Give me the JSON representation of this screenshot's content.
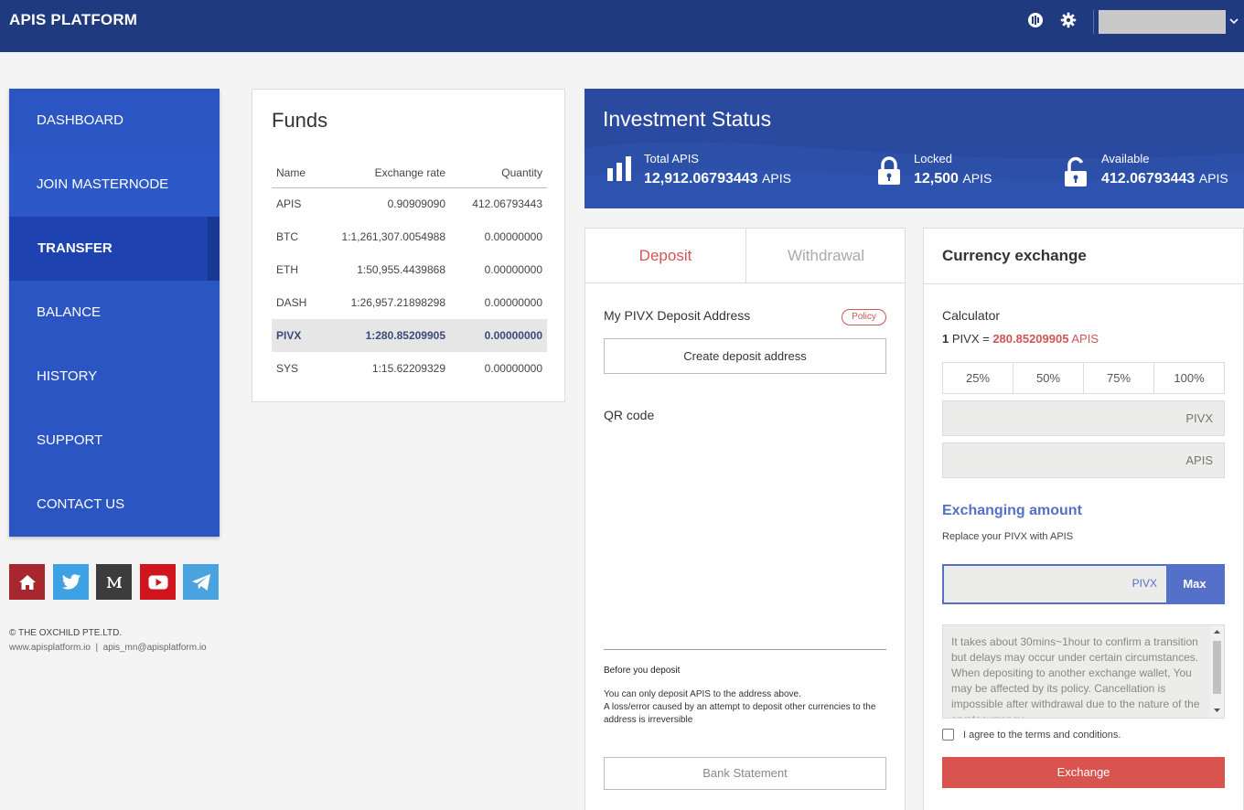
{
  "header": {
    "brand": "APIS PLATFORM"
  },
  "sidebar": {
    "items": [
      {
        "label": "DASHBOARD"
      },
      {
        "label": "JOIN MASTERNODE"
      },
      {
        "label": "TRANSFER"
      },
      {
        "label": "BALANCE"
      },
      {
        "label": "HISTORY"
      },
      {
        "label": "SUPPORT"
      },
      {
        "label": "CONTACT US"
      }
    ],
    "active": "TRANSFER",
    "social": [
      "home-icon",
      "twitter-icon",
      "medium-icon",
      "youtube-icon",
      "telegram-icon"
    ],
    "copyright": "© THE OXCHILD PTE.LTD.",
    "contact": "www.apisplatform.io  |  apis_mn@apisplatform.io"
  },
  "funds": {
    "title": "Funds",
    "headers": [
      "Name",
      "Exchange rate",
      "Quantity"
    ],
    "rows": [
      {
        "name": "APIS",
        "rate": "0.90909090",
        "qty": "412.06793443"
      },
      {
        "name": "BTC",
        "rate": "1:1,261,307.0054988",
        "qty": "0.00000000"
      },
      {
        "name": "ETH",
        "rate": "1:50,955.4439868",
        "qty": "0.00000000"
      },
      {
        "name": "DASH",
        "rate": "1:26,957.21898298",
        "qty": "0.00000000"
      },
      {
        "name": "PIVX",
        "rate": "1:280.85209905",
        "qty": "0.00000000"
      },
      {
        "name": "SYS",
        "rate": "1:15.62209329",
        "qty": "0.00000000"
      }
    ],
    "selected": "PIVX"
  },
  "investment": {
    "title": "Investment Status",
    "total": {
      "label": "Total APIS",
      "value": "12,912.06793443",
      "unit": "APIS"
    },
    "locked": {
      "label": "Locked",
      "value": "12,500",
      "unit": "APIS"
    },
    "available": {
      "label": "Available",
      "value": "412.06793443",
      "unit": "APIS"
    }
  },
  "deposit": {
    "tab_deposit": "Deposit",
    "tab_withdrawal": "Withdrawal",
    "address_label": "My PIVX Deposit Address",
    "policy": "Policy",
    "create_button": "Create deposit address",
    "qr_label": "QR code",
    "before_title": "Before you deposit",
    "before_line1": "You can only deposit APIS to the address above.",
    "before_line2": "A loss/error caused by an attempt to deposit other currencies to the address is irreversible",
    "bank_button": "Bank Statement"
  },
  "exchange": {
    "title": "Currency exchange",
    "calculator": "Calculator",
    "rate_qty": "1",
    "rate_from": "PIVX =",
    "rate_value": "280.85209905",
    "rate_unit": "APIS",
    "percents": [
      "25%",
      "50%",
      "75%",
      "100%"
    ],
    "input_from_unit": "PIVX",
    "input_to_unit": "APIS",
    "amount_title": "Exchanging amount",
    "amount_sub": "Replace your PIVX with APIS",
    "amount_unit": "PIVX",
    "max": "Max",
    "notice": "It takes about 30mins~1hour to confirm a transition but delays may occur under certain circumstances. When depositing to another exchange wallet, You may be affected by its policy. Cancellation is impossible after withdrawal due to the nature of the cryptocurrency.",
    "agree": "I agree to the terms and conditions.",
    "exchange_button": "Exchange"
  },
  "colors": {
    "header": "#1f3a7f",
    "sidebar": "#2b55c2",
    "accent_red": "#d9534f",
    "accent_blue": "#5570c8"
  }
}
